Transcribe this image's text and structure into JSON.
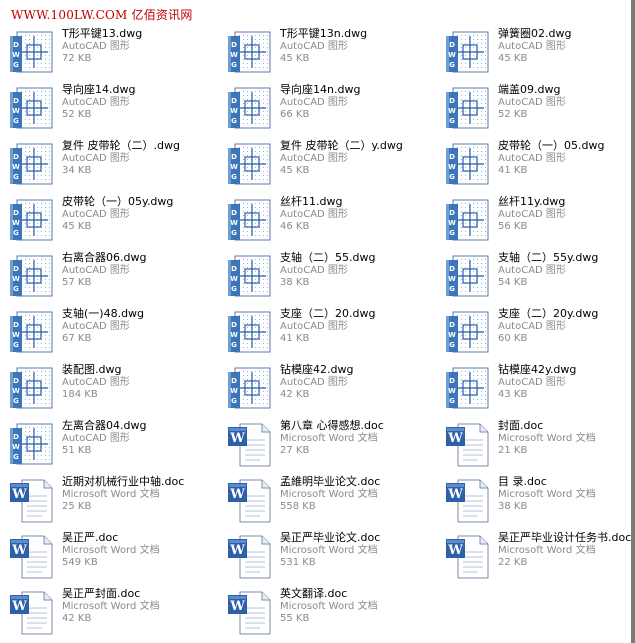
{
  "watermark": "WWW.100LW.COM 亿佰资讯网",
  "files": [
    {
      "name": "T形平键13.dwg",
      "type": "AutoCAD 图形",
      "size": "72 KB",
      "icon": "dwg-icon"
    },
    {
      "name": "T形平键13n.dwg",
      "type": "AutoCAD 图形",
      "size": "45 KB",
      "icon": "dwg-icon"
    },
    {
      "name": "弹簧圈02.dwg",
      "type": "AutoCAD 图形",
      "size": "45 KB",
      "icon": "dwg-icon"
    },
    {
      "name": "导向座14.dwg",
      "type": "AutoCAD 图形",
      "size": "52 KB",
      "icon": "dwg-icon"
    },
    {
      "name": "导向座14n.dwg",
      "type": "AutoCAD 图形",
      "size": "66 KB",
      "icon": "dwg-icon"
    },
    {
      "name": "端盖09.dwg",
      "type": "AutoCAD 图形",
      "size": "52 KB",
      "icon": "dwg-icon"
    },
    {
      "name": "复件 皮带轮（二）.dwg",
      "type": "AutoCAD 图形",
      "size": "34 KB",
      "icon": "dwg-icon"
    },
    {
      "name": "复件 皮带轮（二）y.dwg",
      "type": "AutoCAD 图形",
      "size": "45 KB",
      "icon": "dwg-icon"
    },
    {
      "name": "皮带轮（一）05.dwg",
      "type": "AutoCAD 图形",
      "size": "41 KB",
      "icon": "dwg-icon"
    },
    {
      "name": "皮带轮（一）05y.dwg",
      "type": "AutoCAD 图形",
      "size": "45 KB",
      "icon": "dwg-icon"
    },
    {
      "name": "丝杆11.dwg",
      "type": "AutoCAD 图形",
      "size": "46 KB",
      "icon": "dwg-icon"
    },
    {
      "name": "丝杆11y.dwg",
      "type": "AutoCAD 图形",
      "size": "56 KB",
      "icon": "dwg-icon"
    },
    {
      "name": "右离合器06.dwg",
      "type": "AutoCAD 图形",
      "size": "57 KB",
      "icon": "dwg-icon"
    },
    {
      "name": "支轴（二）55.dwg",
      "type": "AutoCAD 图形",
      "size": "38 KB",
      "icon": "dwg-icon"
    },
    {
      "name": "支轴（二）55y.dwg",
      "type": "AutoCAD 图形",
      "size": "54 KB",
      "icon": "dwg-icon"
    },
    {
      "name": "支轴(一)48.dwg",
      "type": "AutoCAD 图形",
      "size": "67 KB",
      "icon": "dwg-icon"
    },
    {
      "name": "支座（二）20.dwg",
      "type": "AutoCAD 图形",
      "size": "41 KB",
      "icon": "dwg-icon"
    },
    {
      "name": "支座（二）20y.dwg",
      "type": "AutoCAD 图形",
      "size": "60 KB",
      "icon": "dwg-icon"
    },
    {
      "name": "装配图.dwg",
      "type": "AutoCAD 图形",
      "size": "184 KB",
      "icon": "dwg-icon"
    },
    {
      "name": "钻模座42.dwg",
      "type": "AutoCAD 图形",
      "size": "42 KB",
      "icon": "dwg-icon"
    },
    {
      "name": "钻模座42y.dwg",
      "type": "AutoCAD 图形",
      "size": "43 KB",
      "icon": "dwg-icon"
    },
    {
      "name": "左离合器04.dwg",
      "type": "AutoCAD 图形",
      "size": "51 KB",
      "icon": "dwg-icon"
    },
    {
      "name": "第八章 心得感想.doc",
      "type": "Microsoft Word 文档",
      "size": "27 KB",
      "icon": "word-doc-icon"
    },
    {
      "name": "封面.doc",
      "type": "Microsoft Word 文档",
      "size": "21 KB",
      "icon": "word-doc-icon"
    },
    {
      "name": "近期对机械行业中轴.doc",
      "type": "Microsoft Word 文档",
      "size": "25 KB",
      "icon": "word-doc-icon"
    },
    {
      "name": "孟維明毕业论文.doc",
      "type": "Microsoft Word 文档",
      "size": "558 KB",
      "icon": "word-doc-icon"
    },
    {
      "name": "目  录.doc",
      "type": "Microsoft Word 文档",
      "size": "38 KB",
      "icon": "word-doc-icon"
    },
    {
      "name": "吴正严.doc",
      "type": "Microsoft Word 文档",
      "size": "549 KB",
      "icon": "word-doc-icon"
    },
    {
      "name": "吴正严毕业论文.doc",
      "type": "Microsoft Word 文档",
      "size": "531 KB",
      "icon": "word-doc-icon"
    },
    {
      "name": "吴正严毕业设计任务书.doc",
      "type": "Microsoft Word 文档",
      "size": "22 KB",
      "icon": "word-doc-icon"
    },
    {
      "name": "吴正严封面.doc",
      "type": "Microsoft Word 文档",
      "size": "42 KB",
      "icon": "word-doc-icon"
    },
    {
      "name": "英文翻译.doc",
      "type": "Microsoft Word 文档",
      "size": "55 KB",
      "icon": "word-doc-icon"
    }
  ]
}
